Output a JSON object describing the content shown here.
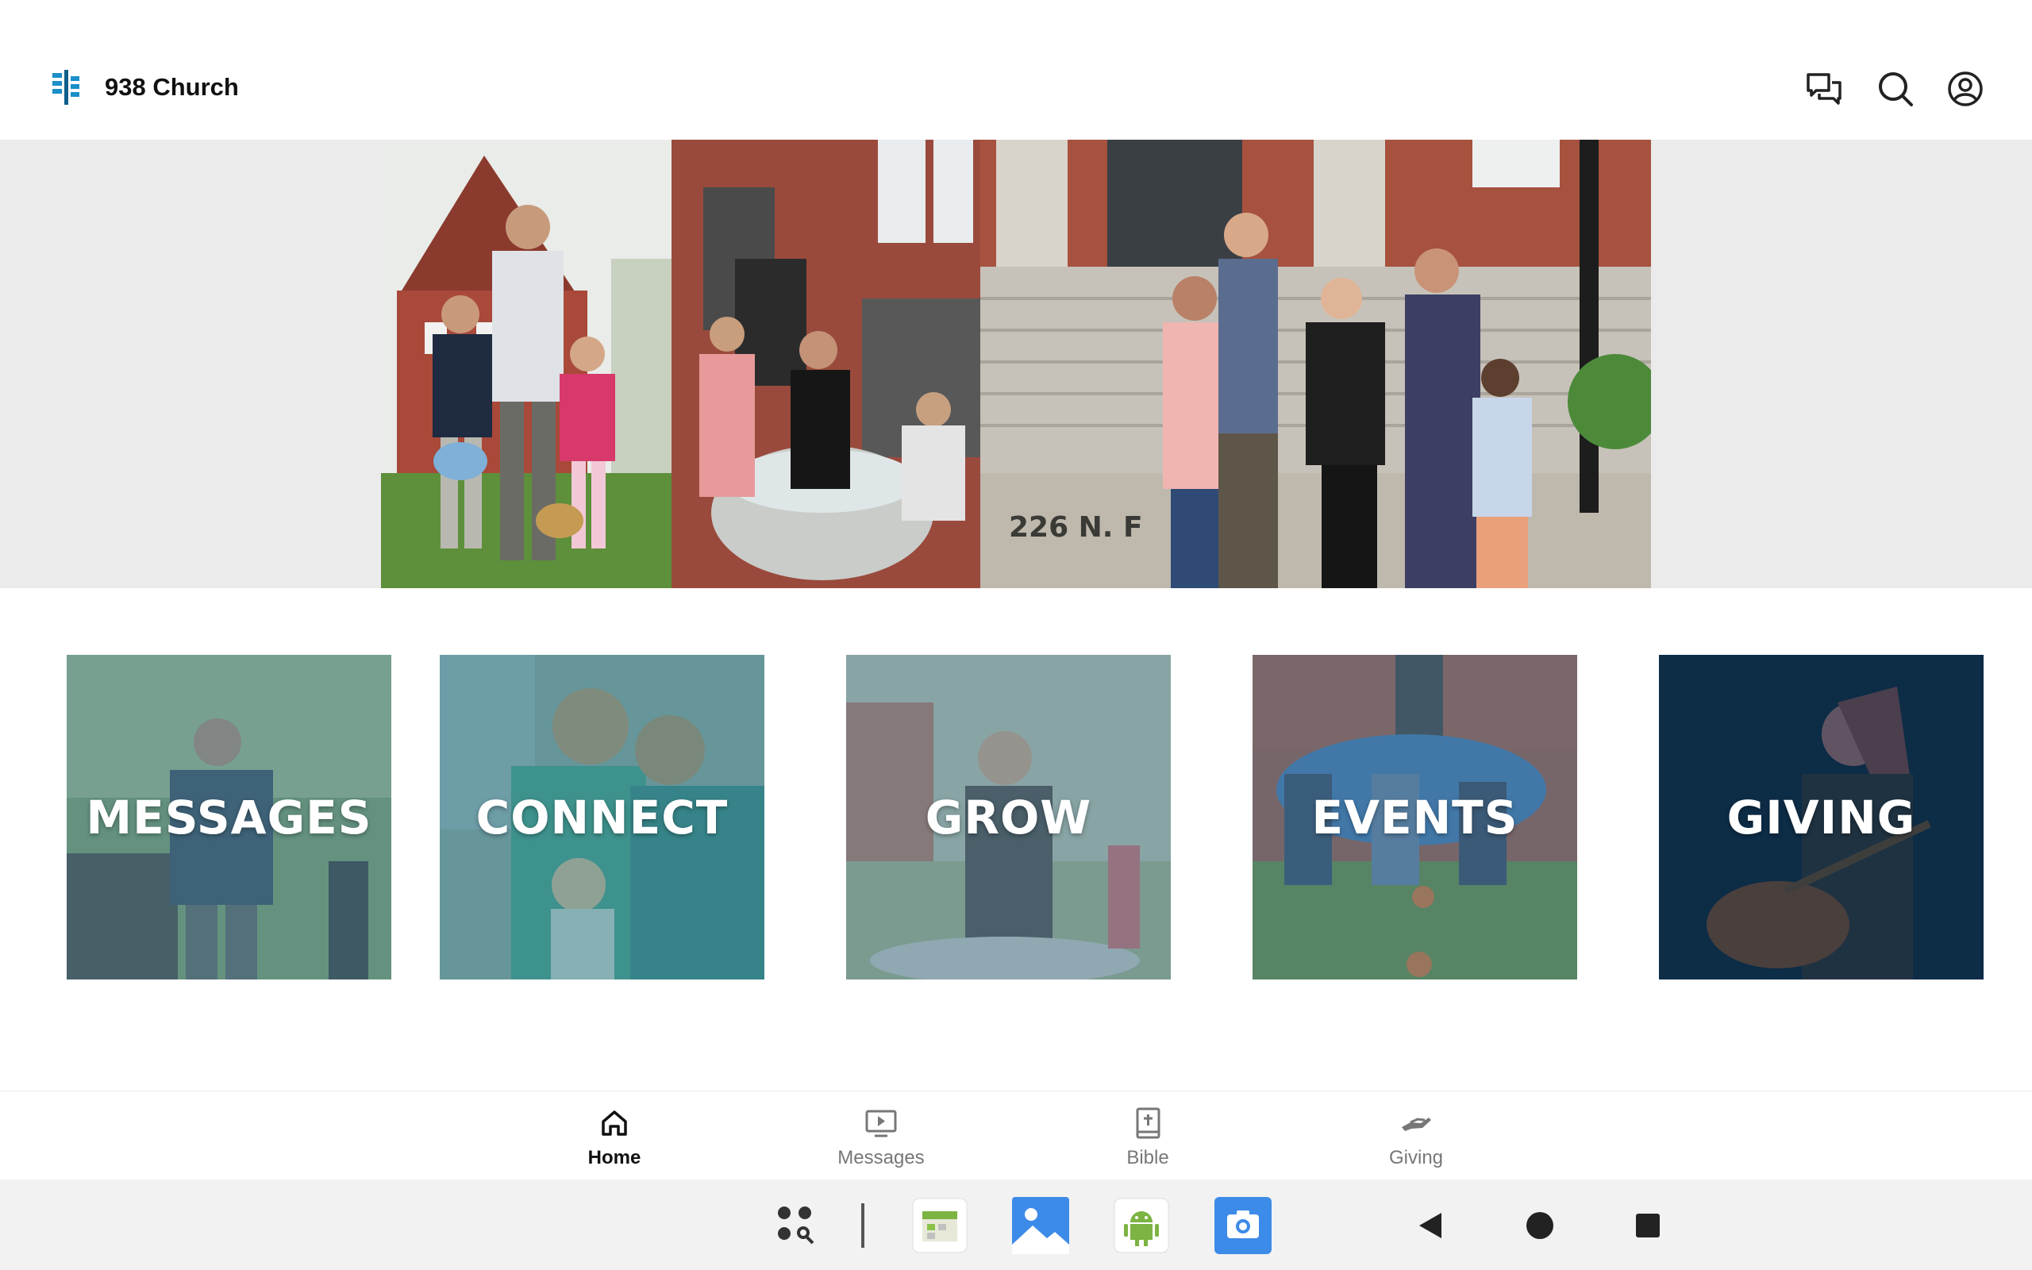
{
  "app": {
    "title": "938 Church",
    "accent": "#1a8fc8"
  },
  "header": {
    "icons": [
      "chat-icon",
      "search-icon",
      "account-icon"
    ]
  },
  "hero": {
    "photos": [
      "easter-family-photo",
      "baptism-photo",
      "church-steps-group-photo"
    ],
    "address_sign": "226 N. F"
  },
  "tiles": [
    {
      "label": "MESSAGES",
      "tint": "#4f7f92"
    },
    {
      "label": "CONNECT",
      "tint": "#3e8a8c"
    },
    {
      "label": "GROW",
      "tint": "#6f93a3"
    },
    {
      "label": "EVENTS",
      "tint": "#4b7795"
    },
    {
      "label": "GIVING",
      "tint": "#0b2a44"
    }
  ],
  "bottom_nav": {
    "items": [
      {
        "label": "Home",
        "icon": "home-icon",
        "active": true
      },
      {
        "label": "Messages",
        "icon": "play-screen-icon",
        "active": false
      },
      {
        "label": "Bible",
        "icon": "bible-icon",
        "active": false
      },
      {
        "label": "Giving",
        "icon": "giving-hand-icon",
        "active": false
      }
    ]
  },
  "system_bar": {
    "apps": [
      "app-drawer-search-icon",
      "calendar-app-icon",
      "gallery-app-icon",
      "android-app-icon",
      "camera-app-icon"
    ],
    "nav": [
      "back-icon",
      "home-circle-icon",
      "recents-icon"
    ]
  }
}
